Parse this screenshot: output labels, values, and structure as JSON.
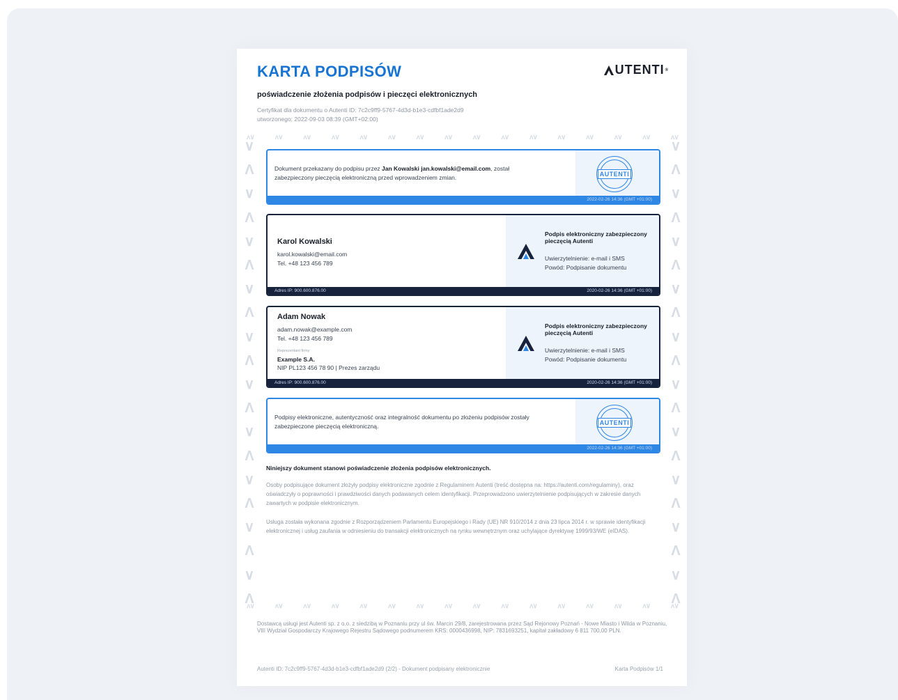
{
  "header": {
    "title": "KARTA PODPISÓW",
    "logo_text": "UTENTI",
    "logo_reg": "®"
  },
  "subtitle": "poświadczenie złożenia podpisów i pieczęci elektronicznych",
  "certificate": {
    "line1": "Certyfikat dla dokumentu o Autenti ID: 7c2c9ff9-5767-4d3d-b1e3-cdfbf1ade2d9",
    "line2": "utworzonego: 2022-09-03 08:39 (GMT+02:00)"
  },
  "seal_box_1": {
    "text_before": "Dokument przekazany do podpisu przez ",
    "text_bold": "Jan Kowalski jan.kowalski@email.com",
    "text_after": ", został zabezpieczony pieczęcią elektroniczną przed wprowadzeniem zmian.",
    "stamp": "AUTENTI",
    "timestamp": "2022-02-26 14:36 (GMT +01:00)"
  },
  "signers": [
    {
      "name": "Karol Kowalski",
      "email": "karol.kowalski@email.com",
      "phone": "Tel. +48 123 456 789",
      "sig_title": "Podpis elektroniczny zabezpieczony pieczęcią Autenti",
      "auth": "Uwierzytelnienie: e-mail i SMS",
      "reason": "Powód: Podpisanie dokumentu",
      "ip": "Adres IP: 900.600.876.00",
      "timestamp": "2020-02-26 14:36 (GMT +01:00)"
    },
    {
      "name": "Adam Nowak",
      "email": "adam.nowak@example.com",
      "phone": "Tel. +48 123 456 789",
      "representing_label": "Reprezentant firmy",
      "company": "Example S.A.",
      "company_details": "NIP PL123 456 78 90 | Prezes zarządu",
      "sig_title": "Podpis elektroniczny zabezpieczony pieczęcią Autenti",
      "auth": "Uwierzytelnienie: e-mail i SMS",
      "reason": "Powód: Podpisanie dokumentu",
      "ip": "Adres IP: 900.600.876.00",
      "timestamp": "2020-02-26 14:36 (GMT +01:00)"
    }
  ],
  "seal_box_2": {
    "text": "Podpisy elektroniczne, autentyczność oraz integralność dokumentu po złożeniu podpisów zostały zabezpieczone pieczęcią elektroniczną.",
    "stamp": "AUTENTI",
    "timestamp": "2022-02-26 14:36 (GMT +01:00)"
  },
  "statement": {
    "title": "Niniejszy dokument stanowi poświadczenie złożenia podpisów elektronicznych.",
    "para1": "Osoby podpisujące dokument złożyły podpisy elektroniczne zgodnie z Regulaminem Autenti (treść dostępna na: https://autenti.com/regulaminy), oraz oświadczyły o poprawności i prawdziwości danych podawanych celem identyfikacji. Przeprowadzono uwierzytelnienie podpisujących w zakresie danych zawartych w podpisie elektronicznym.",
    "para2": "Usługa została wykonana zgodnie z Rozporządzeniem Parlamentu Europejskiego i Rady (UE) NR 910/2014 z dnia 23 lipca 2014 r. w sprawie identyfikacji elektronicznej i usług zaufania w odniesieniu do transakcji elektronicznych na rynku wewnętrznym oraz uchylające dyrektywę 1999/93/WE (eIDAS)."
  },
  "legal": "Dostawcą usługi jest Autenti sp. z o.o. z siedzibą w Poznaniu przy ul św. Marcin 29/8, zarejestrowana przez Sąd Rejonowy Poznań - Nowe Miasto i Wilda w Poznaniu, VIII Wydział Gospodarczy Krajowego Rejestru Sądowego podnumerem KRS: 0000436998, NIP: 7831693251, kapitał zakładowy 6 811 700,00 PLN.",
  "footer": {
    "left": "Autenti ID: 7c2c9ff9-5767-4d3d-b1e3-cdfbf1ade2d9 (2/2) - Dokument podpisany elektronicznie",
    "right": "Karta Podpisów 1/1"
  },
  "colors": {
    "accent": "#1774d2",
    "box_blue": "#2e86e5",
    "box_dark": "#17223d",
    "page_bg": "#eef1f6"
  }
}
